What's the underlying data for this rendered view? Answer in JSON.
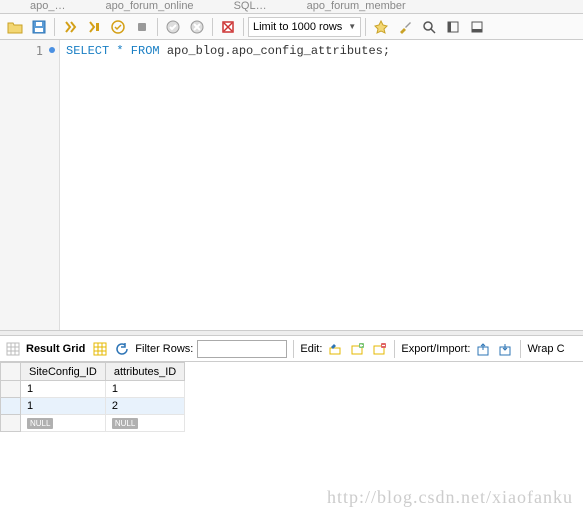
{
  "tabs": [
    "apo_…",
    "apo_forum_online",
    "SQL…",
    "apo_forum_member"
  ],
  "toolbar": {
    "limit_label": "Limit to 1000 rows"
  },
  "editor": {
    "line_number": "1",
    "sql_keywords": "SELECT * FROM",
    "sql_rest": " apo_blog.apo_config_attributes;"
  },
  "result_bar": {
    "grid_label": "Result Grid",
    "filter_label": "Filter Rows:",
    "filter_value": "",
    "edit_label": "Edit:",
    "export_label": "Export/Import:",
    "wrap_label": "Wrap C"
  },
  "grid": {
    "columns": [
      "SiteConfig_ID",
      "attributes_ID"
    ],
    "rows": [
      {
        "c0": "1",
        "c1": "1"
      },
      {
        "c0": "1",
        "c1": "2"
      }
    ],
    "null_label": "NULL"
  },
  "watermark": "http://blog.csdn.net/xiaofanku"
}
